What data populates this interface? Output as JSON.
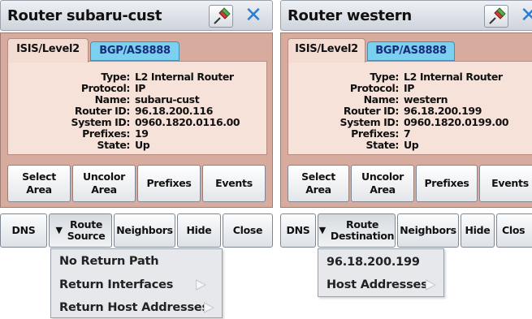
{
  "left": {
    "title": "Router subaru-cust",
    "tabs": [
      "ISIS/Level2",
      "BGP/AS8888"
    ],
    "info": [
      {
        "key": "Type:",
        "value": "L2 Internal Router"
      },
      {
        "key": "Protocol:",
        "value": "IP"
      },
      {
        "key": "Name:",
        "value": "subaru-cust"
      },
      {
        "key": "Router ID:",
        "value": "96.18.200.116"
      },
      {
        "key": "System ID:",
        "value": "0960.1820.0116.00"
      },
      {
        "key": "Prefixes:",
        "value": "19"
      },
      {
        "key": "State:",
        "value": "Up"
      }
    ],
    "actions": [
      "Select Area",
      "Uncolor Area",
      "Prefixes",
      "Events"
    ],
    "bottom": {
      "dns": "DNS",
      "route_line1": "Route",
      "route_line2": "Source",
      "neighbors": "Neighbors",
      "hide": "Hide",
      "close": "Close"
    },
    "menu": [
      "No Return Path",
      "Return Interfaces",
      "Return Host Addresses"
    ]
  },
  "right": {
    "title": "Router western",
    "tabs": [
      "ISIS/Level2",
      "BGP/AS8888"
    ],
    "info": [
      {
        "key": "Type:",
        "value": "L2 Internal Router"
      },
      {
        "key": "Protocol:",
        "value": "IP"
      },
      {
        "key": "Name:",
        "value": "western"
      },
      {
        "key": "Router ID:",
        "value": "96.18.200.199"
      },
      {
        "key": "System ID:",
        "value": "0960.1820.0199.00"
      },
      {
        "key": "Prefixes:",
        "value": "7"
      },
      {
        "key": "State:",
        "value": "Up"
      }
    ],
    "actions": [
      "Select Area",
      "Uncolor Area",
      "Prefixes",
      "Events"
    ],
    "bottom": {
      "dns": "DNS",
      "route_line1": "Route",
      "route_line2": "Destination",
      "neighbors": "Neighbors",
      "hide": "Hide",
      "close": "Clos"
    },
    "menu": [
      "96.18.200.199",
      "Host Addresses"
    ]
  },
  "icons": {
    "pin": "pushpin-icon",
    "close": "close-icon",
    "dropdown": "triangle-down-icon",
    "submenu": "triangle-right-icon"
  },
  "colors": {
    "body_bg": "#d8ab9f",
    "info_bg": "#f7e2d9",
    "inactive_tab": "#7bd0f0",
    "close_x": "#2a7fd4",
    "pin_green": "#5ab04a",
    "pin_red": "#d23a3a"
  }
}
